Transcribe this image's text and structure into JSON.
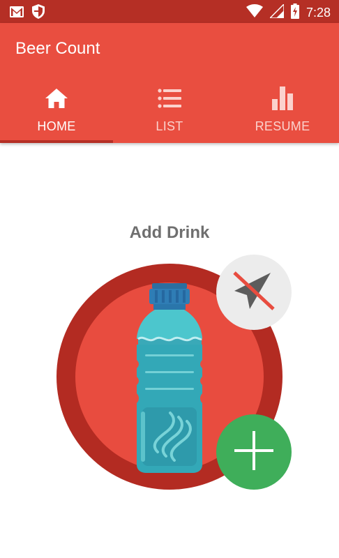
{
  "status_bar": {
    "time": "7:28",
    "left_icons": [
      "gmail-icon",
      "shield-icon"
    ],
    "right_icons": [
      "wifi-icon",
      "signal-icon",
      "battery-charging-icon"
    ]
  },
  "app_bar": {
    "title": "Beer Count",
    "color": "#e94e40"
  },
  "tabs": [
    {
      "label": "HOME",
      "icon": "home-icon",
      "active": true
    },
    {
      "label": "LIST",
      "icon": "list-icon",
      "active": false
    },
    {
      "label": "RESUME",
      "icon": "bar-chart-icon",
      "active": false
    }
  ],
  "main": {
    "title": "Add Drink",
    "illustration": "water-bottle-icon",
    "location_button_icon": "location-off-icon",
    "add_button_icon": "plus-icon",
    "colors": {
      "ring": "#b32b22",
      "circle": "#e84c3f",
      "add_button": "#3fae5a",
      "location_button": "#ececec"
    }
  }
}
